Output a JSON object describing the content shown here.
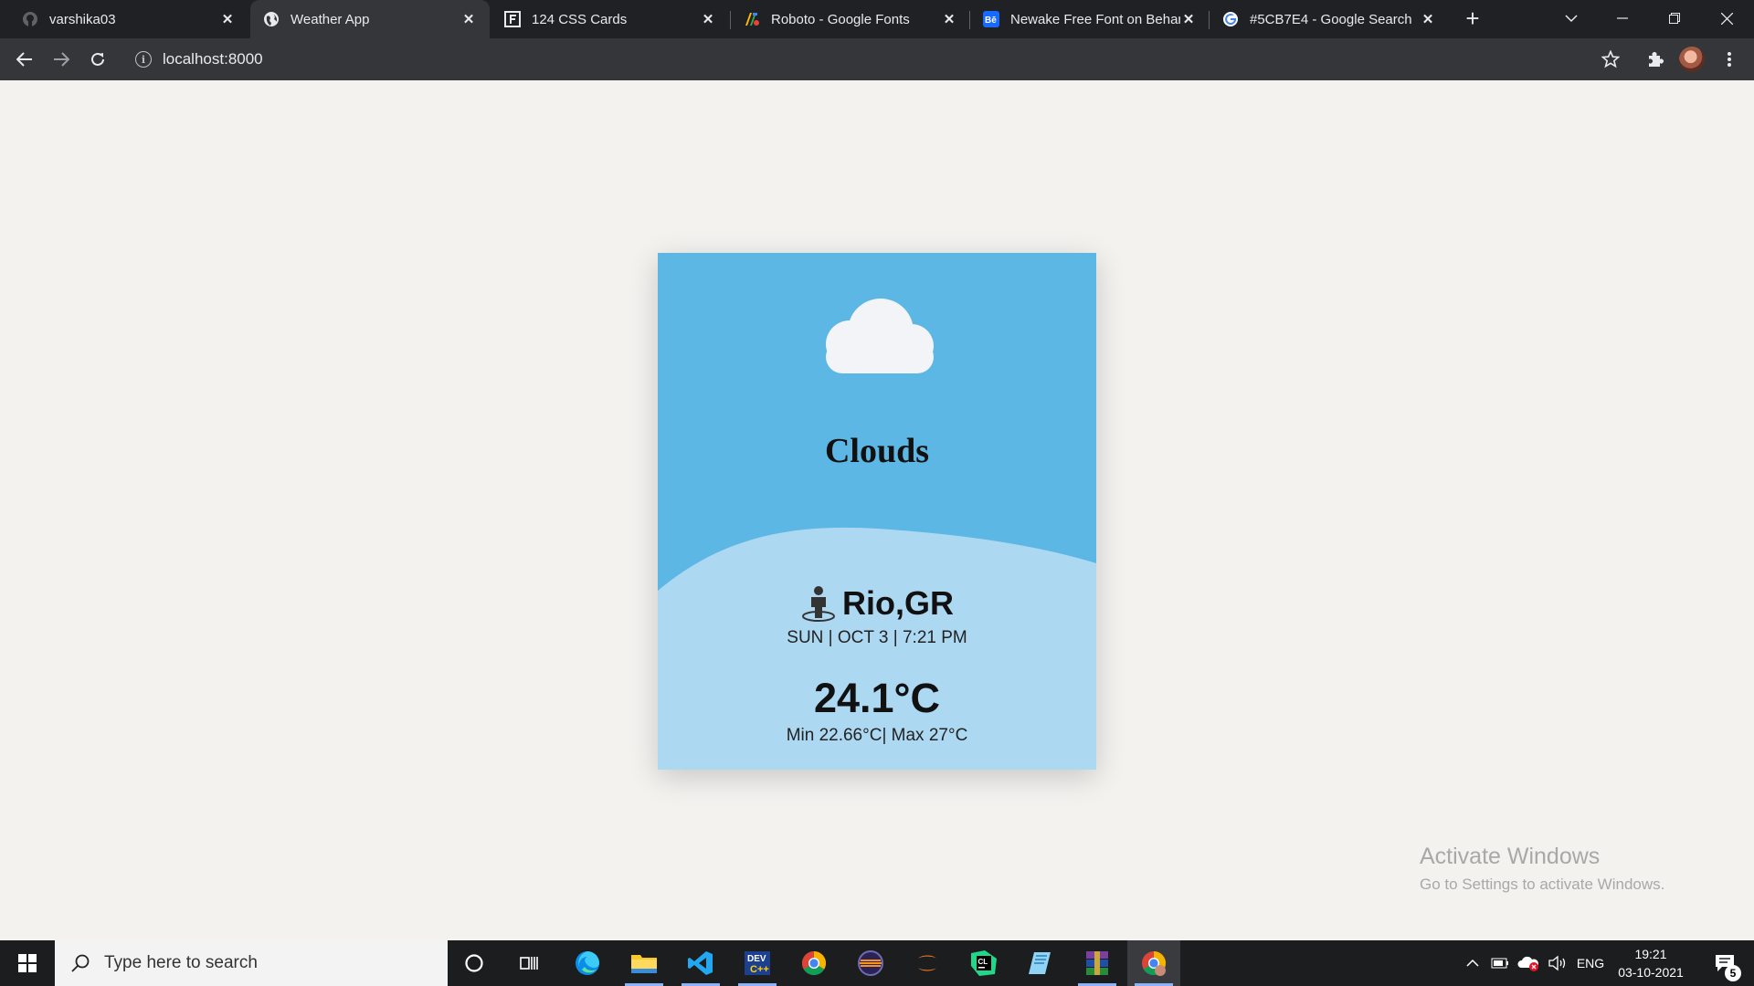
{
  "browser": {
    "tabs": [
      {
        "title": "varshika03",
        "icon": "github-icon"
      },
      {
        "title": "Weather App",
        "icon": "globe-icon",
        "active": true
      },
      {
        "title": "124 CSS Cards",
        "icon": "f-logo-icon"
      },
      {
        "title": "Roboto - Google Fonts",
        "icon": "google-fonts-icon"
      },
      {
        "title": "Newake Free Font on Behance",
        "icon": "behance-icon"
      },
      {
        "title": "#5CB7E4 - Google Search",
        "icon": "google-icon"
      }
    ],
    "url": "localhost:8000"
  },
  "weather": {
    "condition": "Clouds",
    "location": "Rio,GR",
    "datetime": "SUN | OCT 3 | 7:21 PM",
    "temperature": "24.1°C",
    "minmax": "Min 22.66°C| Max 27°C",
    "card_color": "#5CB7E4",
    "lower_color": "#ADD8F2"
  },
  "watermark": {
    "line1": "Activate Windows",
    "line2": "Go to Settings to activate Windows."
  },
  "taskbar": {
    "search_placeholder": "Type here to search",
    "tray_language": "ENG",
    "time": "19:21",
    "date": "03-10-2021",
    "notification_count": "5",
    "apps": [
      "cortana-icon",
      "task-view-icon",
      "edge-icon",
      "file-explorer-icon",
      "vscode-icon",
      "dev-c-icon",
      "chrome-icon",
      "eclipse-icon",
      "jupyter-icon",
      "clion-icon",
      "notepad-icon",
      "winrar-icon",
      "chrome-active-icon"
    ]
  }
}
